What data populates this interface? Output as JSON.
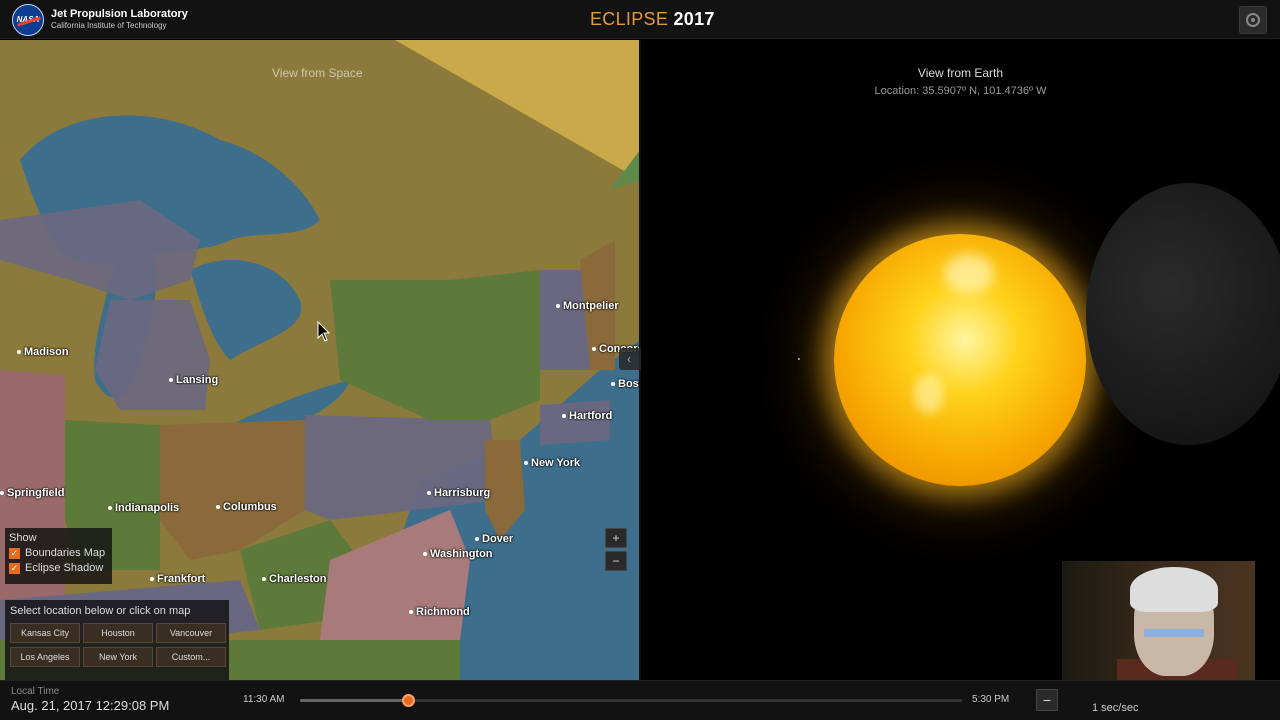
{
  "header": {
    "org_title": "Jet Propulsion Laboratory",
    "org_subtitle": "California Institute of Technology",
    "logo_text": "NASA",
    "app_title_prefix": "ECLIPSE",
    "app_title_year": "2017",
    "settings_icon": "settings-icon"
  },
  "map": {
    "view_label": "View from Space",
    "cities": [
      {
        "name": "Madison"
      },
      {
        "name": "Lansing"
      },
      {
        "name": "Springfield"
      },
      {
        "name": "Indianapolis"
      },
      {
        "name": "Columbus"
      },
      {
        "name": "Frankfort"
      },
      {
        "name": "Charleston"
      },
      {
        "name": "Richmond"
      },
      {
        "name": "Washington"
      },
      {
        "name": "Dover"
      },
      {
        "name": "Harrisburg"
      },
      {
        "name": "New York"
      },
      {
        "name": "Hartford"
      },
      {
        "name": "Montpelier"
      },
      {
        "name": "Concord"
      },
      {
        "name": "Boston"
      }
    ],
    "show": {
      "title": "Show",
      "options": [
        {
          "label": "Boundaries Map",
          "checked": true
        },
        {
          "label": "Eclipse Shadow",
          "checked": true
        }
      ]
    },
    "locations": {
      "hint": "Select location below or click on map",
      "buttons": [
        "Kansas City",
        "Houston",
        "Vancouver",
        "Los Angeles",
        "New York",
        "Custom..."
      ]
    },
    "zoom_in_icon": "+",
    "zoom_out_icon": "−"
  },
  "earth_view": {
    "view_label": "View from Earth",
    "location": "Location: 35.5907º N, 101.4736º W"
  },
  "bottom": {
    "local_label": "Local Time",
    "local_value": "Aug. 21, 2017 12:29:08 PM",
    "time_start": "11:30 AM",
    "time_end": "5:30 PM",
    "timeline_position": 0.163,
    "speed_minus": "−",
    "speed_readout": "1 sec/sec"
  },
  "colors": {
    "accent": "#e86b1e",
    "title_orange": "#e59a3a",
    "water": "#3d6e8c",
    "shadow_band": "#8b7a3c"
  }
}
